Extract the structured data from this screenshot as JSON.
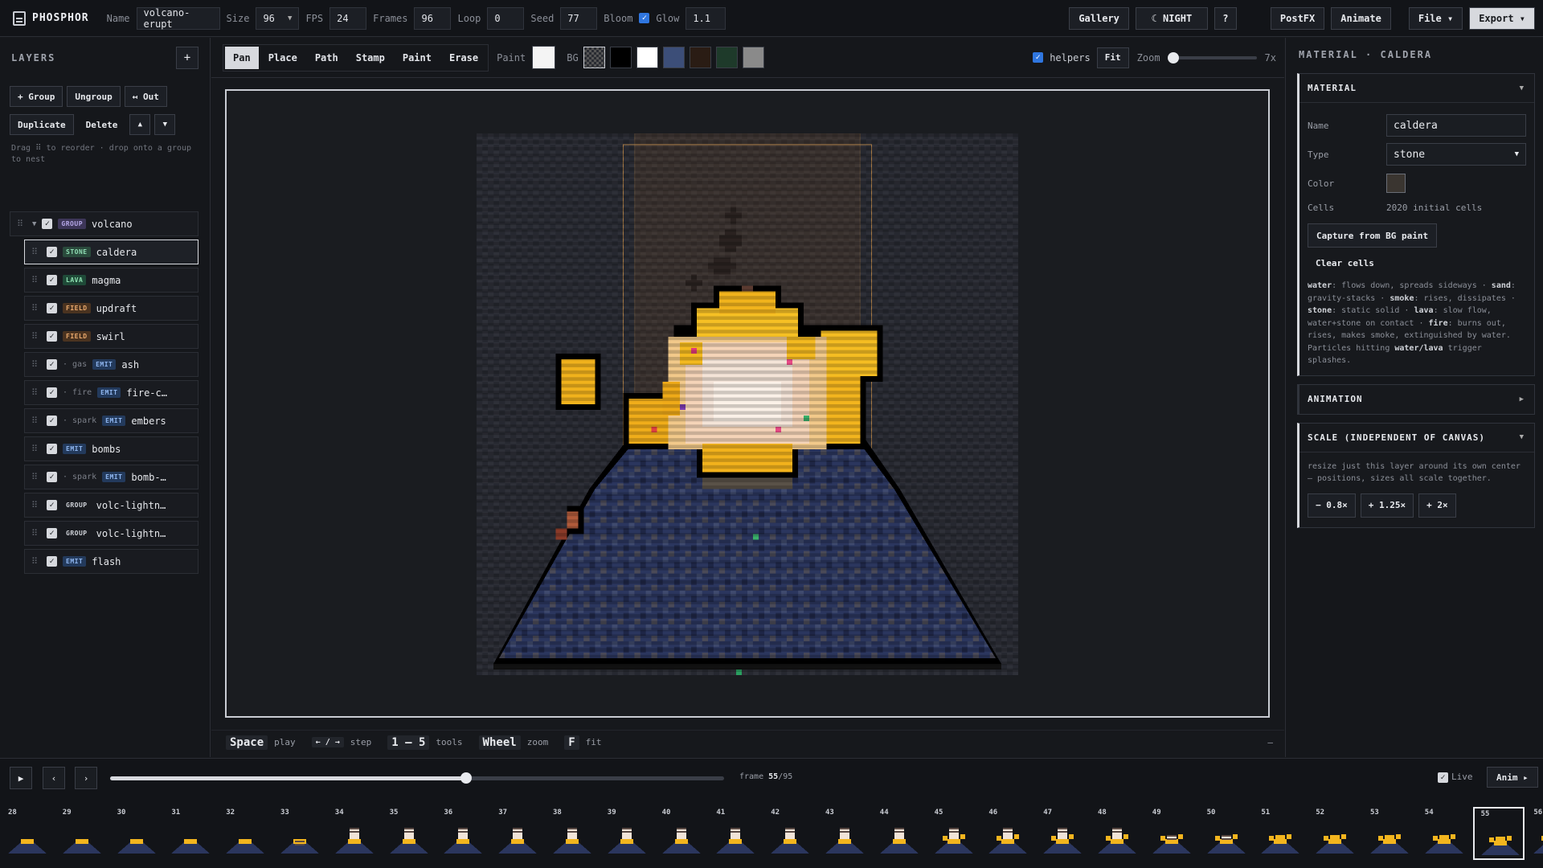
{
  "app": {
    "title": "PHOSPHOR"
  },
  "topbar": {
    "name_label": "Name",
    "name_value": "volcano-erupt",
    "size_label": "Size",
    "size_value": "96",
    "fps_label": "FPS",
    "fps_value": "24",
    "frames_label": "Frames",
    "frames_value": "96",
    "loop_label": "Loop",
    "loop_value": "0",
    "seed_label": "Seed",
    "seed_value": "77",
    "bloom_label": "Bloom",
    "bloom_checked": true,
    "glow_label": "Glow",
    "glow_value": "1.1",
    "gallery": "Gallery",
    "night": "☾ NIGHT",
    "help": "?",
    "postfx": "PostFX",
    "animate": "Animate",
    "file": "File ▾",
    "export": "Export ▾"
  },
  "layers_panel": {
    "title": "LAYERS",
    "add": "+",
    "group_btn": "+ Group",
    "ungroup_btn": "Ungroup",
    "out_btn": "↤ Out",
    "duplicate_btn": "Duplicate",
    "delete_btn": "Delete",
    "up_btn": "▲",
    "down_btn": "▼",
    "hint": "Drag ⠿ to reorder · drop onto a group to nest",
    "items": [
      {
        "tag": "GROUP",
        "kind": "group",
        "sub": "",
        "name": "volcano",
        "top": true
      },
      {
        "tag": "STONE",
        "kind": "stone",
        "sub": "",
        "name": "caldera",
        "selected": true
      },
      {
        "tag": "LAVA",
        "kind": "lava",
        "sub": "",
        "name": "magma"
      },
      {
        "tag": "FIELD",
        "kind": "field",
        "sub": "",
        "name": "updraft"
      },
      {
        "tag": "FIELD",
        "kind": "field",
        "sub": "",
        "name": "swirl"
      },
      {
        "tag": "EMIT",
        "kind": "emit",
        "sub": "· gas",
        "name": "ash"
      },
      {
        "tag": "EMIT",
        "kind": "emit",
        "sub": "· fire",
        "name": "fire-c…"
      },
      {
        "tag": "EMIT",
        "kind": "emit",
        "sub": "· spark",
        "name": "embers"
      },
      {
        "tag": "EMIT",
        "kind": "emit",
        "sub": "",
        "name": "bombs"
      },
      {
        "tag": "EMIT",
        "kind": "emit",
        "sub": "· spark",
        "name": "bomb-…"
      },
      {
        "tag": "GROUP",
        "kind": "groupd",
        "sub": "",
        "name": "volc-lightn…"
      },
      {
        "tag": "GROUP",
        "kind": "groupd",
        "sub": "",
        "name": "volc-lightn…"
      },
      {
        "tag": "EMIT",
        "kind": "emit",
        "sub": "",
        "name": "flash"
      }
    ]
  },
  "tools": {
    "items": [
      "Pan",
      "Place",
      "Path",
      "Stamp",
      "Paint",
      "Erase"
    ],
    "active": "Pan",
    "paint_label": "Paint",
    "paint_color": "#f4f4f4",
    "bg_label": "BG",
    "bg_swatches": [
      "checker",
      "#000000",
      "#ffffff",
      "#3c4e78",
      "#2a1c14",
      "#1e3a2a",
      "#8a8a8a"
    ],
    "helpers_label": "helpers",
    "helpers_checked": true,
    "fit": "Fit",
    "zoom_label": "Zoom",
    "zoom_value": "7x",
    "zoom_level": 0.06
  },
  "keyhints": {
    "space": "Space",
    "play": "play",
    "arrows": "← / →",
    "step": "step",
    "nums": "1 – 5",
    "tools": "tools",
    "wheel": "Wheel",
    "zoom": "zoom",
    "f": "F",
    "fit": "fit",
    "collapse": "–"
  },
  "inspector": {
    "header": "MATERIAL · CALDERA",
    "material_section": "MATERIAL",
    "name_label": "Name",
    "name_value": "caldera",
    "type_label": "Type",
    "type_value": "stone",
    "color_label": "Color",
    "color_value": "#3a3530",
    "cells_label": "Cells",
    "cells_value": "2020 initial cells",
    "capture_btn": "Capture from BG paint",
    "clear_btn": "Clear cells",
    "desc": [
      {
        "b": "water",
        "t": ": flows down, spreads sideways · "
      },
      {
        "b": "sand",
        "t": ": gravity-stacks · "
      },
      {
        "b": "smoke",
        "t": ": rises, dissipates · "
      },
      {
        "b": "stone",
        "t": ": static solid · "
      },
      {
        "b": "lava",
        "t": ": slow flow, water+stone on contact · "
      },
      {
        "b": "fire",
        "t": ": burns out, rises, makes smoke, extinguished by water. Particles hitting "
      },
      {
        "b": "water/lava",
        "t": " trigger splashes."
      }
    ],
    "animation_section": "ANIMATION",
    "scale_section": "SCALE (INDEPENDENT OF CANVAS)",
    "scale_desc": "resize just this layer around its own center — positions, sizes all scale together.",
    "scale_btns": [
      "− 0.8×",
      "+ 1.25×",
      "+ 2×"
    ]
  },
  "timeline": {
    "play": "▶",
    "prev": "‹",
    "next": "›",
    "frame_label": "frame",
    "frame_current": "55",
    "frame_total": "/95",
    "progress": 0.58,
    "live_label": "Live",
    "live_checked": true,
    "anim_btn": "Anim ▸",
    "frames": [
      "28",
      "29",
      "30",
      "31",
      "32",
      "33",
      "34",
      "35",
      "36",
      "37",
      "38",
      "39",
      "40",
      "41",
      "42",
      "43",
      "44",
      "45",
      "46",
      "47",
      "48",
      "49",
      "50",
      "51",
      "52",
      "53",
      "54",
      "55",
      "56"
    ],
    "selected_frame": "55"
  },
  "colors": {
    "accent": "#d7d9de",
    "bg": "#16181c",
    "lava": "#f5b21f",
    "mountain": "#2e3a66"
  }
}
